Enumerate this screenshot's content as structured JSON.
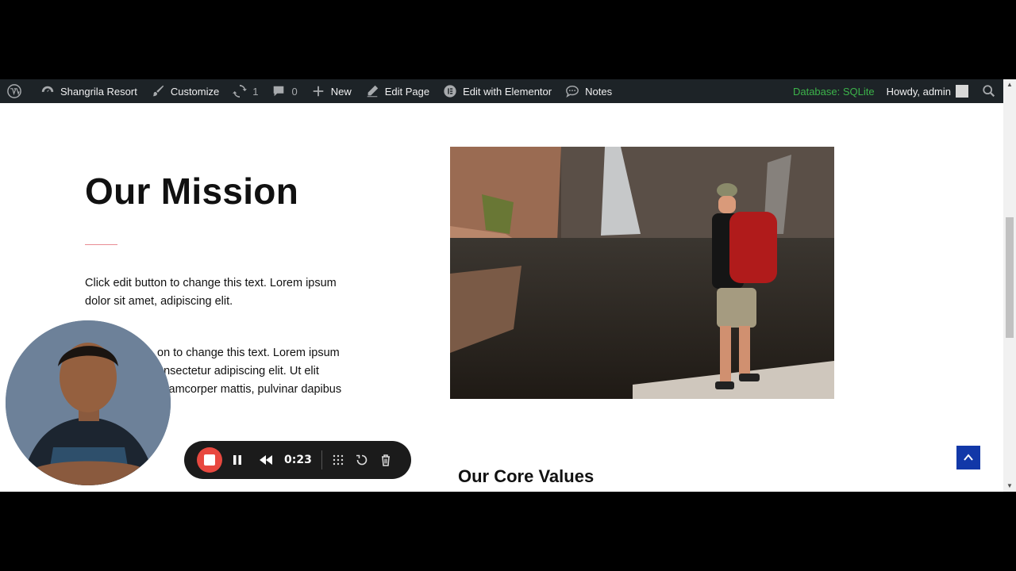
{
  "admin_bar": {
    "site_name": "Shangrila Resort",
    "customize_label": "Customize",
    "updates_count": "1",
    "comments_count": "0",
    "new_label": "New",
    "edit_page_label": "Edit Page",
    "elementor_label": "Edit with Elementor",
    "notes_label": "Notes",
    "database_label": "Database: SQLite",
    "greeting": "Howdy, admin"
  },
  "content": {
    "mission_title": "Our Mission",
    "paragraph_1": "Click edit button to change this text. Lorem ipsum dolor sit amet, adipiscing elit.",
    "paragraph_2": "on to change this text. Lorem ipsum onsectetur adipiscing elit. Ut elit ullamcorper mattis, pulvinar dapibus",
    "core_values_title": "Our Core Values"
  },
  "recorder": {
    "elapsed_time": "0:23"
  },
  "colors": {
    "admin_bar_bg": "#1d2327",
    "database_text": "#3cb34a",
    "accent_divider": "#e98c93",
    "back_to_top_bg": "#1238a8",
    "record_stop": "#e8483f"
  }
}
